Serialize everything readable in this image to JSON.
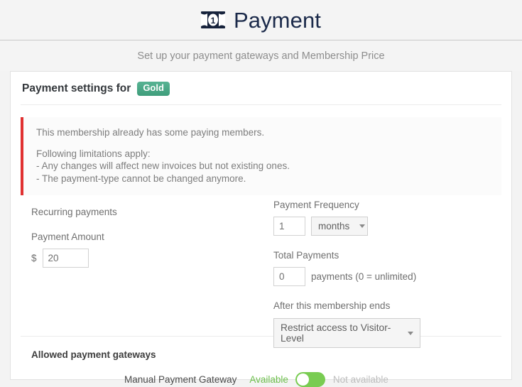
{
  "header": {
    "icon": "money-bill-icon",
    "title": "Payment",
    "subtitle": "Set up your payment gateways and Membership Price"
  },
  "card": {
    "heading_text": "Payment settings for",
    "badge_label": "Gold",
    "badge_color": "#4aa785",
    "alert": {
      "accent_color": "#e03131",
      "line1": "This membership already has some paying members.",
      "line2": "Following limitations apply:",
      "line3": "- Any changes will affect new invoices but not existing ones.",
      "line4": "- The payment-type cannot be changed anymore."
    },
    "form": {
      "recurring_label": "Recurring payments",
      "amount_label": "Payment Amount",
      "currency_symbol": "$",
      "amount_value": "20",
      "amount_placeholder": "0",
      "frequency_label": "Payment Frequency",
      "frequency_value": "1",
      "frequency_placeholder": "1",
      "frequency_unit": "months",
      "total_label": "Total Payments",
      "total_value": "0",
      "total_placeholder": "0",
      "total_helper": "payments (0 = unlimited)",
      "after_end_label": "After this membership ends",
      "after_end_value": "Restrict access to Visitor-Level"
    },
    "gateways": {
      "title": "Allowed payment gateways",
      "rows": [
        {
          "name": "Manual Payment Gateway",
          "on_label": "Available",
          "off_label": "Not available",
          "enabled": true,
          "on_color": "#6cbf4b",
          "track_color": "#79cc52"
        }
      ]
    }
  }
}
